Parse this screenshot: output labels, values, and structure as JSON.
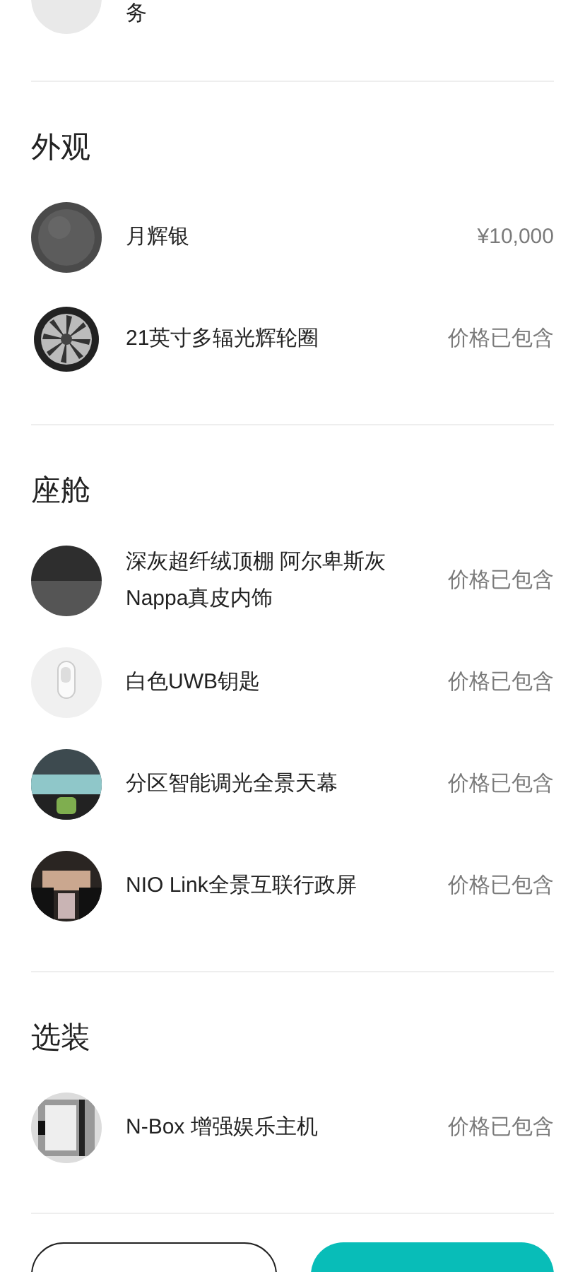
{
  "top_item": {
    "name_tail": "务"
  },
  "sections": [
    {
      "title": "外观",
      "items": [
        {
          "name": "月辉银",
          "price": "¥10,000"
        },
        {
          "name": "21英寸多辐光辉轮圈",
          "price": "价格已包含"
        }
      ]
    },
    {
      "title": "座舱",
      "items": [
        {
          "name": "深灰超纤绒顶棚 阿尔卑斯灰Nappa真皮内饰",
          "price": "价格已包含"
        },
        {
          "name": "白色UWB钥匙",
          "price": "价格已包含"
        },
        {
          "name": "分区智能调光全景天幕",
          "price": "价格已包含"
        },
        {
          "name": "NIO Link全景互联行政屏",
          "price": "价格已包含"
        }
      ]
    },
    {
      "title": "选装",
      "items": [
        {
          "name": "N-Box 增强娱乐主机",
          "price": "价格已包含"
        }
      ]
    }
  ]
}
